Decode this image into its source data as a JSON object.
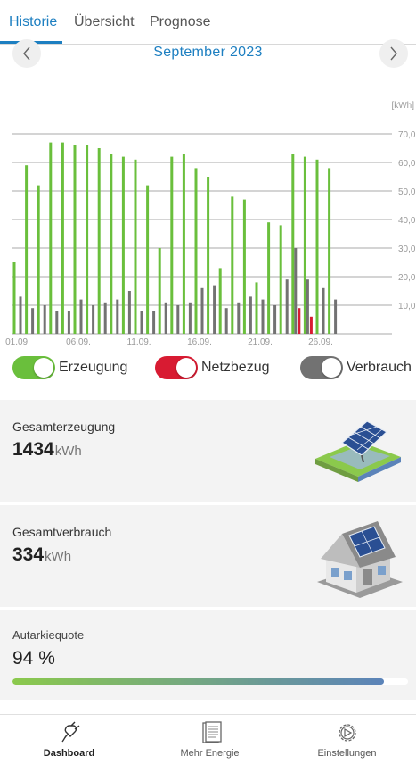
{
  "tabs": [
    {
      "label": "Historie",
      "active": true
    },
    {
      "label": "Übersicht",
      "active": false
    },
    {
      "label": "Prognose",
      "active": false
    }
  ],
  "month_nav": {
    "title": "September 2023",
    "prev_icon": "chevron-left-icon",
    "next_icon": "chevron-right-icon"
  },
  "chart_data": {
    "type": "bar",
    "unit": "[kWh]",
    "ylim": [
      0,
      70
    ],
    "yticks": [
      "70,0",
      "60,0",
      "50,0",
      "40,0",
      "30,0",
      "20,0",
      "10,0"
    ],
    "xticks": [
      "01.09.",
      "06.09.",
      "11.09.",
      "16.09.",
      "21.09.",
      "26.09."
    ],
    "days": [
      1,
      2,
      3,
      4,
      5,
      6,
      7,
      8,
      9,
      10,
      11,
      12,
      13,
      14,
      15,
      16,
      17,
      18,
      19,
      20,
      21,
      22,
      23,
      24,
      25,
      26,
      27,
      28,
      29,
      30
    ],
    "series": [
      {
        "name": "Erzeugung",
        "color": "#6abf3c",
        "values": [
          25,
          59,
          52,
          67,
          67,
          66,
          66,
          65,
          63,
          62,
          61,
          52,
          30,
          62,
          63,
          58,
          55,
          23,
          48,
          47,
          18,
          39,
          38,
          63,
          62,
          61,
          58,
          0,
          0,
          0
        ]
      },
      {
        "name": "Netzbezug",
        "color": "#d81b32",
        "values": [
          0,
          0,
          0,
          0,
          0,
          0,
          0,
          0,
          0,
          0,
          0,
          0,
          0,
          0,
          0,
          0,
          0,
          0,
          0,
          0,
          0,
          0,
          0,
          9,
          6,
          0,
          0,
          0,
          0,
          0
        ]
      },
      {
        "name": "Verbrauch",
        "color": "#727272",
        "values": [
          13,
          9,
          10,
          8,
          8,
          12,
          10,
          11,
          12,
          15,
          8,
          8,
          11,
          10,
          11,
          16,
          17,
          9,
          11,
          13,
          12,
          10,
          19,
          30,
          19,
          16,
          12,
          0,
          0,
          0
        ]
      }
    ]
  },
  "legend": [
    {
      "label": "Erzeugung",
      "color": "#6abf3c",
      "on": true
    },
    {
      "label": "Netzbezug",
      "color": "#d81b32",
      "on": true
    },
    {
      "label": "Verbrauch",
      "color": "#727272",
      "on": true
    }
  ],
  "cards": {
    "erzeugung": {
      "title": "Gesamterzeugung",
      "value": "1434",
      "unit": "kWh",
      "icon": "solar-panel-icon"
    },
    "verbrauch": {
      "title": "Gesamtverbrauch",
      "value": "334",
      "unit": "kWh",
      "icon": "house-solar-icon"
    },
    "autarkie": {
      "title": "Autarkiequote",
      "value": "94 %",
      "progress": 0.94
    }
  },
  "bottom_nav": [
    {
      "label": "Dashboard",
      "icon": "plug-icon",
      "active": true
    },
    {
      "label": "Mehr Energie",
      "icon": "document-icon",
      "active": false
    },
    {
      "label": "Einstellungen",
      "icon": "gear-icon",
      "active": false
    }
  ]
}
